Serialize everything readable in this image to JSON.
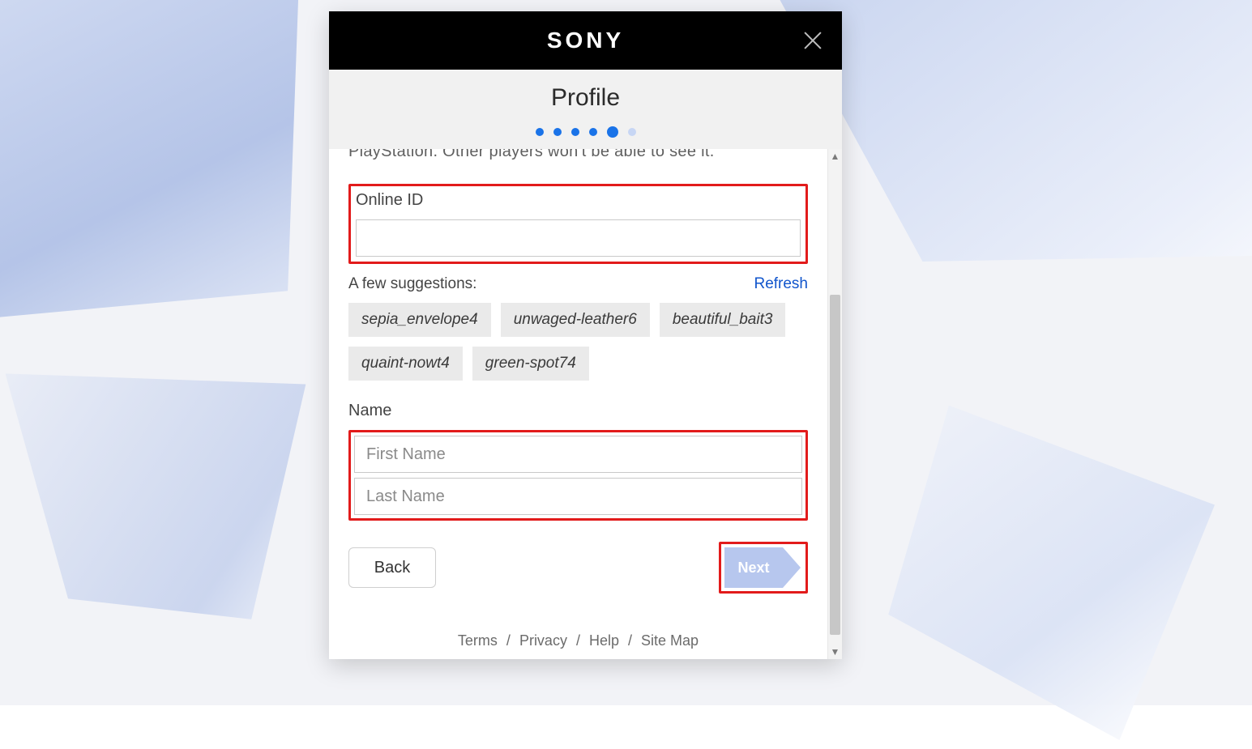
{
  "brand": {
    "logo_text": "SONY"
  },
  "header": {
    "title": "Profile"
  },
  "stepper": {
    "total": 6,
    "current_index": 4
  },
  "partial_top_text": "PlayStation. Other players won't be able to see it.",
  "online_id": {
    "label": "Online ID",
    "value": "",
    "suggestions_label": "A few suggestions:",
    "refresh_label": "Refresh",
    "suggestions": [
      "sepia_envelope4",
      "unwaged-leather6",
      "beautiful_bait3",
      "quaint-nowt4",
      "green-spot74"
    ]
  },
  "name": {
    "label": "Name",
    "first_placeholder": "First Name",
    "last_placeholder": "Last Name",
    "first_value": "",
    "last_value": ""
  },
  "actions": {
    "back_label": "Back",
    "next_label": "Next"
  },
  "footer": {
    "links": [
      "Terms",
      "Privacy",
      "Help",
      "Site Map"
    ],
    "separator": "/"
  }
}
